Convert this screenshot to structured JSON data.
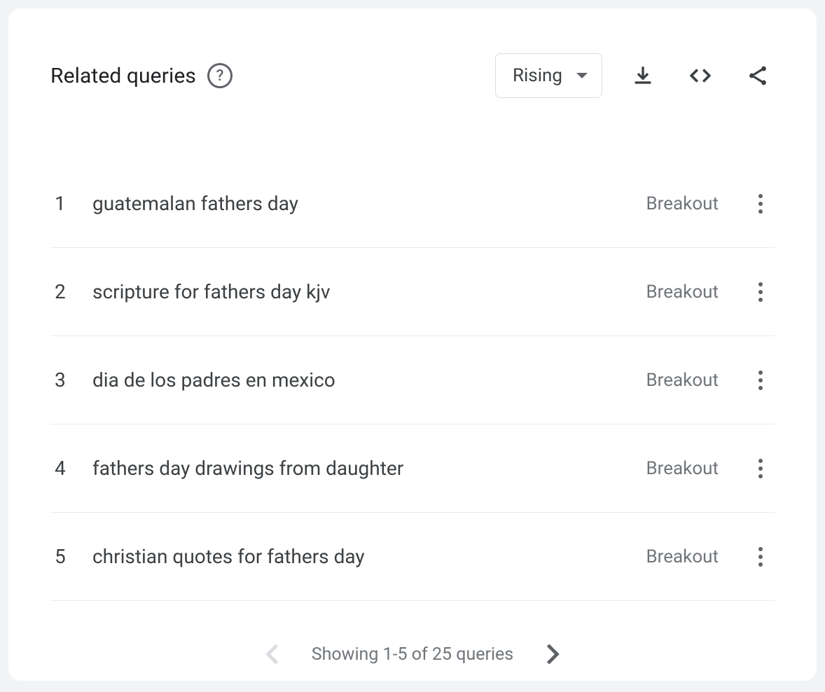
{
  "header": {
    "title": "Related queries",
    "dropdown_label": "Rising"
  },
  "queries": [
    {
      "rank": "1",
      "text": "guatemalan fathers day",
      "metric": "Breakout"
    },
    {
      "rank": "2",
      "text": "scripture for fathers day kjv",
      "metric": "Breakout"
    },
    {
      "rank": "3",
      "text": "dia de los padres en mexico",
      "metric": "Breakout"
    },
    {
      "rank": "4",
      "text": "fathers day drawings from daughter",
      "metric": "Breakout"
    },
    {
      "rank": "5",
      "text": "christian quotes for fathers day",
      "metric": "Breakout"
    }
  ],
  "pager": {
    "label": "Showing 1-5 of 25 queries"
  }
}
